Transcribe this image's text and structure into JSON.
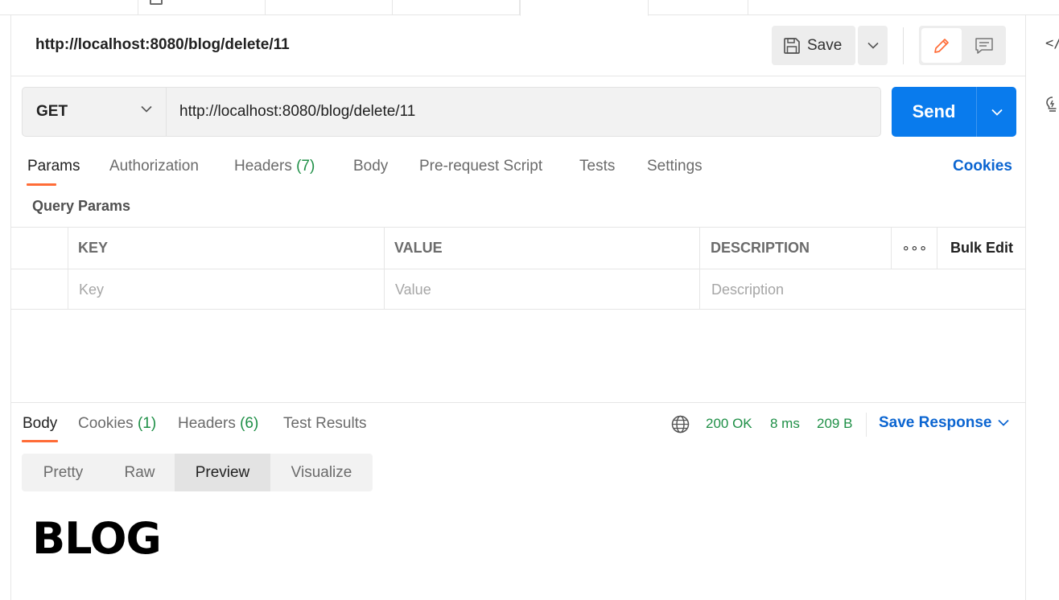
{
  "header": {
    "title": "http://localhost:8080/blog/delete/11",
    "save_label": "Save"
  },
  "request": {
    "method": "GET",
    "url": "http://localhost:8080/blog/delete/11",
    "send_label": "Send"
  },
  "request_tabs": {
    "params": "Params",
    "authorization": "Authorization",
    "headers": "Headers",
    "headers_count": "(7)",
    "body": "Body",
    "pre_request": "Pre-request Script",
    "tests": "Tests",
    "settings": "Settings",
    "cookies": "Cookies"
  },
  "query_params": {
    "title": "Query Params",
    "columns": {
      "key": "KEY",
      "value": "VALUE",
      "description": "DESCRIPTION"
    },
    "placeholders": {
      "key": "Key",
      "value": "Value",
      "description": "Description"
    },
    "more_label": "∘∘∘",
    "bulk_edit": "Bulk Edit"
  },
  "response": {
    "tabs": {
      "body": "Body",
      "cookies": "Cookies",
      "cookies_count": "(1)",
      "headers": "Headers",
      "headers_count": "(6)",
      "test_results": "Test Results"
    },
    "status": "200 OK",
    "time": "8 ms",
    "size": "209 B",
    "save_response": "Save Response",
    "views": [
      "Pretty",
      "Raw",
      "Preview",
      "Visualize"
    ],
    "active_view": "Preview",
    "preview_heading": "BLOG"
  },
  "colors": {
    "accent": "#ff6c37",
    "primary": "#097bed",
    "link": "#0b65d1",
    "success": "#1e8f46"
  },
  "icons": {
    "save": "floppy-disk-icon",
    "edit": "pencil-icon",
    "comment": "comment-icon",
    "code": "code-icon",
    "bulb": "lightbulb-icon",
    "globe": "globe-icon"
  }
}
